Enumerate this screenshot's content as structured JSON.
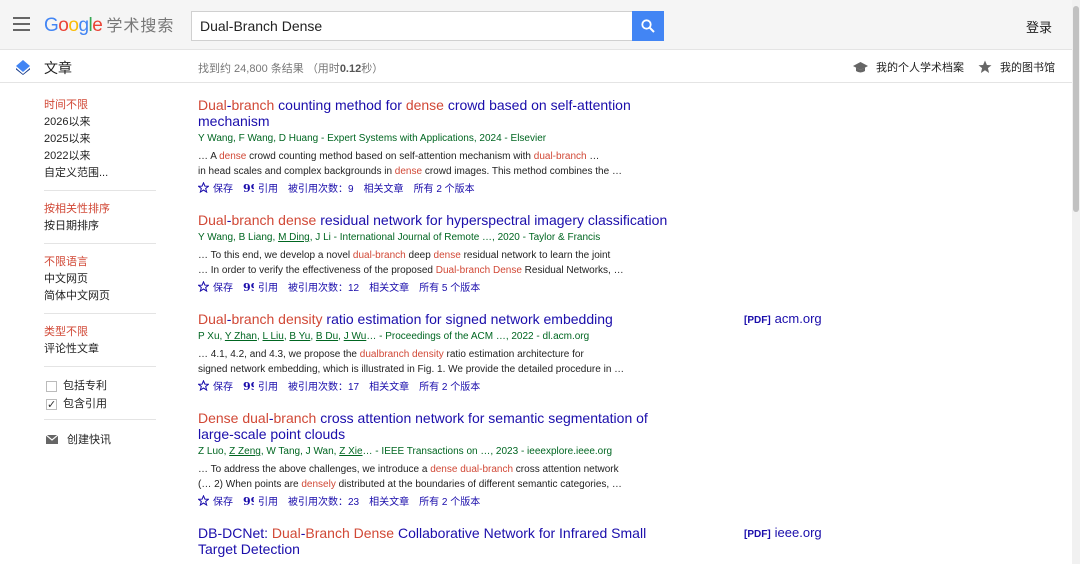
{
  "header": {
    "logo_google": [
      "G",
      "o",
      "o",
      "g",
      "l",
      "e"
    ],
    "logo_scholar": "学术搜索",
    "search_value": "Dual-Branch Dense",
    "login_label": "登录"
  },
  "subheader": {
    "articles_label": "文章",
    "stats_prefix": "找到约 24,800 条结果 （用时",
    "stats_time": "0.12",
    "stats_suffix": "秒）",
    "profile_label": "我的个人学术档案",
    "library_label": "我的图书馆"
  },
  "sidebar": {
    "time_group": [
      "时间不限",
      "2026以来",
      "2025以来",
      "2022以来",
      "自定义范围..."
    ],
    "sort_group": [
      "按相关性排序",
      "按日期排序"
    ],
    "lang_group": [
      "不限语言",
      "中文网页",
      "简体中文网页"
    ],
    "type_group": [
      "类型不限",
      "评论性文章"
    ],
    "include_patents": "包括专利",
    "include_citations": "包含引用",
    "create_alert": "创建快讯"
  },
  "results": [
    {
      "title_parts": [
        {
          "t": "Dual",
          "hl": true
        },
        {
          "t": "-",
          "hl": false
        },
        {
          "t": "branch",
          "hl": true
        },
        {
          "t": " counting method for ",
          "hl": false
        },
        {
          "t": "dense",
          "hl": true
        },
        {
          "t": " crowd based on self-attention mechanism",
          "hl": false
        }
      ],
      "authors_parts": [
        {
          "t": "Y Wang, F Wang, D Huang - Expert Systems with Applications, 2024 - Elsevier",
          "u": false
        }
      ],
      "snippet1": [
        {
          "t": "… A ",
          "hl": false
        },
        {
          "t": "dense",
          "hl": true
        },
        {
          "t": " crowd counting method based on self-attention mechanism with ",
          "hl": false
        },
        {
          "t": "dual-branch",
          "hl": true
        },
        {
          "t": " …",
          "hl": false
        }
      ],
      "snippet2": [
        {
          "t": "in head scales and complex backgrounds in ",
          "hl": false
        },
        {
          "t": "dense",
          "hl": true
        },
        {
          "t": " crowd images. This method combines the …",
          "hl": false
        }
      ],
      "save": "保存",
      "cite": "引用",
      "cited_by": "被引用次数：9",
      "related": "相关文章",
      "versions": "所有 2 个版本",
      "pdf_tag": "",
      "pdf_source": ""
    },
    {
      "title_parts": [
        {
          "t": "Dual",
          "hl": true
        },
        {
          "t": "-",
          "hl": false
        },
        {
          "t": "branch dense",
          "hl": true
        },
        {
          "t": " residual network for hyperspectral imagery classification",
          "hl": false
        }
      ],
      "authors_parts": [
        {
          "t": "Y Wang, B Liang, ",
          "u": false
        },
        {
          "t": "M Ding",
          "u": true
        },
        {
          "t": ", J Li - International Journal of Remote …, 2020 - Taylor & Francis",
          "u": false
        }
      ],
      "snippet1": [
        {
          "t": "… To this end, we develop a novel ",
          "hl": false
        },
        {
          "t": "dual-branch",
          "hl": true
        },
        {
          "t": " deep ",
          "hl": false
        },
        {
          "t": "dense",
          "hl": true
        },
        {
          "t": " residual network to learn the joint",
          "hl": false
        }
      ],
      "snippet2": [
        {
          "t": "… In order to verify the effectiveness of the proposed ",
          "hl": false
        },
        {
          "t": "Dual-branch Dense",
          "hl": true
        },
        {
          "t": " Residual Networks, …",
          "hl": false
        }
      ],
      "save": "保存",
      "cite": "引用",
      "cited_by": "被引用次数：12",
      "related": "相关文章",
      "versions": "所有 5 个版本",
      "pdf_tag": "",
      "pdf_source": ""
    },
    {
      "title_parts": [
        {
          "t": "Dual",
          "hl": true
        },
        {
          "t": "-",
          "hl": false
        },
        {
          "t": "branch density",
          "hl": true
        },
        {
          "t": " ratio estimation for signed network embedding",
          "hl": false
        }
      ],
      "authors_parts": [
        {
          "t": "P Xu, ",
          "u": false
        },
        {
          "t": "Y Zhan",
          "u": true
        },
        {
          "t": ", ",
          "u": false
        },
        {
          "t": "L Liu",
          "u": true
        },
        {
          "t": ", ",
          "u": false
        },
        {
          "t": "B Yu",
          "u": true
        },
        {
          "t": ", ",
          "u": false
        },
        {
          "t": "B Du",
          "u": true
        },
        {
          "t": ", ",
          "u": false
        },
        {
          "t": "J Wu",
          "u": true
        },
        {
          "t": "… - Proceedings of the ACM …, 2022 - dl.acm.org",
          "u": false
        }
      ],
      "snippet1": [
        {
          "t": "… 4.1, 4.2, and 4.3, we propose the ",
          "hl": false
        },
        {
          "t": "dualbranch density",
          "hl": true
        },
        {
          "t": " ratio estimation architecture for",
          "hl": false
        }
      ],
      "snippet2": [
        {
          "t": "signed network embedding, which is illustrated in Fig. 1. We provide the detailed procedure in …",
          "hl": false
        }
      ],
      "save": "保存",
      "cite": "引用",
      "cited_by": "被引用次数：17",
      "related": "相关文章",
      "versions": "所有 2 个版本",
      "pdf_tag": "[PDF]",
      "pdf_source": "acm.org"
    },
    {
      "title_parts": [
        {
          "t": "Dense dual",
          "hl": true
        },
        {
          "t": "-",
          "hl": false
        },
        {
          "t": "branch",
          "hl": true
        },
        {
          "t": " cross attention network for semantic segmentation of large-scale point clouds",
          "hl": false
        }
      ],
      "authors_parts": [
        {
          "t": "Z Luo, ",
          "u": false
        },
        {
          "t": "Z Zeng",
          "u": true
        },
        {
          "t": ", W Tang, J Wan, ",
          "u": false
        },
        {
          "t": "Z Xie",
          "u": true
        },
        {
          "t": "… - IEEE Transactions on …, 2023 - ieeexplore.ieee.org",
          "u": false
        }
      ],
      "snippet1": [
        {
          "t": "… To address the above challenges, we introduce a ",
          "hl": false
        },
        {
          "t": "dense dual-branch",
          "hl": true
        },
        {
          "t": " cross attention network",
          "hl": false
        }
      ],
      "snippet2": [
        {
          "t": "(… 2) When points are ",
          "hl": false
        },
        {
          "t": "densely",
          "hl": true
        },
        {
          "t": " distributed at the boundaries of different semantic categories, …",
          "hl": false
        }
      ],
      "save": "保存",
      "cite": "引用",
      "cited_by": "被引用次数：23",
      "related": "相关文章",
      "versions": "所有 2 个版本",
      "pdf_tag": "",
      "pdf_source": ""
    },
    {
      "title_parts": [
        {
          "t": "DB-DCNet: ",
          "hl": false
        },
        {
          "t": "Dual",
          "hl": true
        },
        {
          "t": "-",
          "hl": false
        },
        {
          "t": "Branch Dense",
          "hl": true
        },
        {
          "t": " Collaborative Network for Infrared Small Target Detection",
          "hl": false
        }
      ],
      "authors_parts": [],
      "snippet1": [],
      "snippet2": [],
      "save": "",
      "cite": "",
      "cited_by": "",
      "related": "",
      "versions": "",
      "pdf_tag": "[PDF]",
      "pdf_source": "ieee.org"
    }
  ],
  "colors": {
    "link": "#1a0dab",
    "highlight": "#d14836",
    "green": "#006621",
    "search_blue": "#4285f4"
  }
}
